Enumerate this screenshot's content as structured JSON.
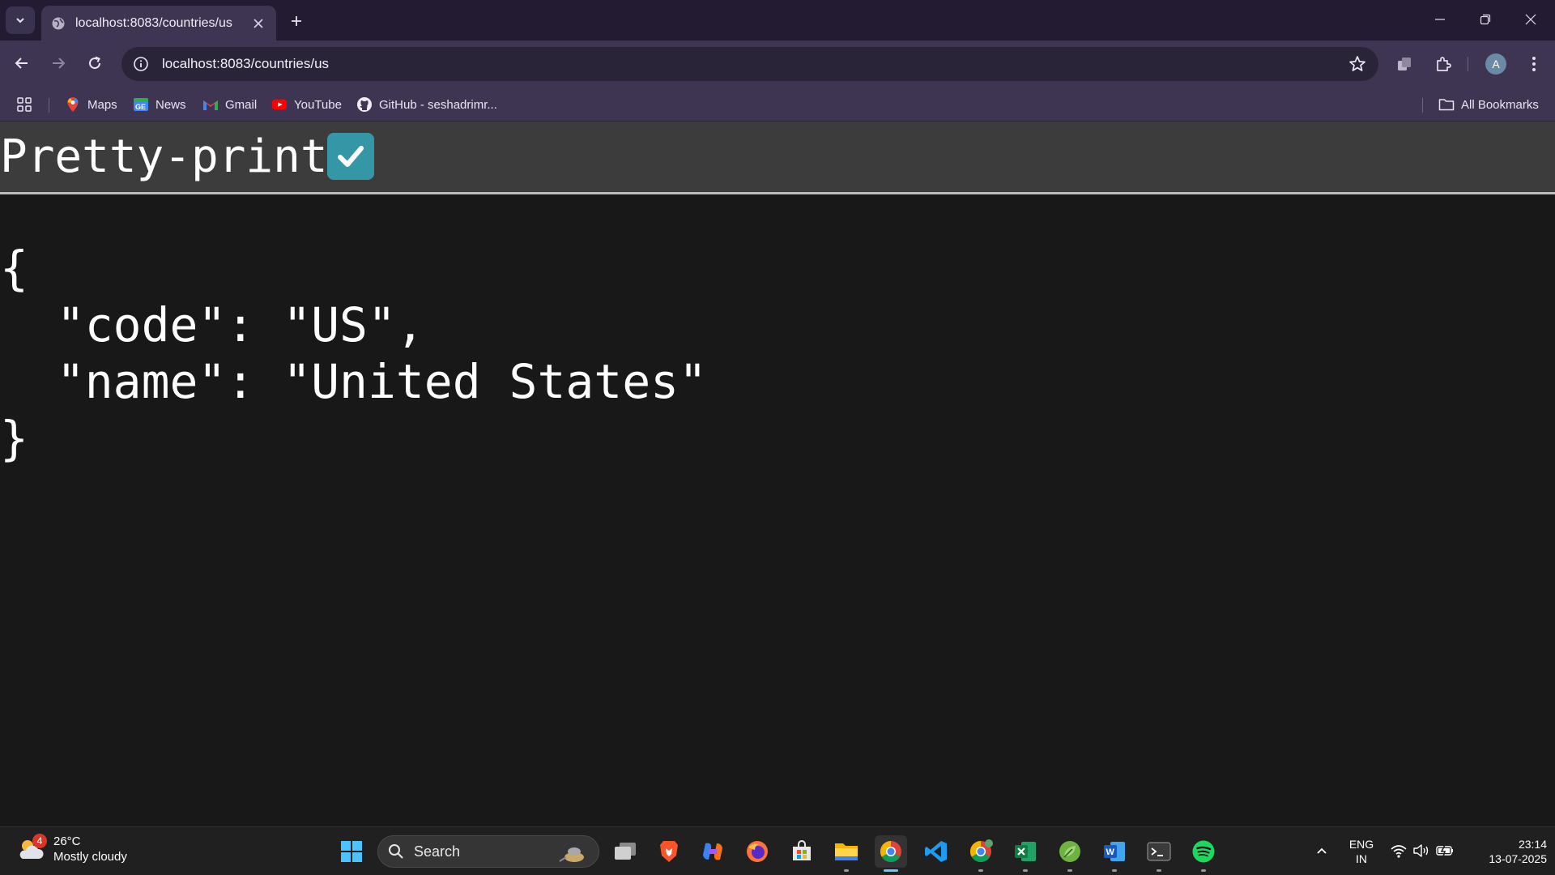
{
  "browser": {
    "tab": {
      "title": "localhost:8083/countries/us"
    },
    "omnibox": {
      "url": "localhost:8083/countries/us"
    },
    "bookmarks": [
      {
        "label": "Maps",
        "icon": "maps-icon"
      },
      {
        "label": "News",
        "icon": "news-icon"
      },
      {
        "label": "Gmail",
        "icon": "gmail-icon"
      },
      {
        "label": "YouTube",
        "icon": "youtube-icon"
      },
      {
        "label": "GitHub - seshadrimr...",
        "icon": "github-icon"
      }
    ],
    "all_bookmarks_label": "All Bookmarks",
    "avatar_letter": "A"
  },
  "page": {
    "pretty_print_label": "Pretty-print",
    "pretty_print_checked": true,
    "json_lines": [
      "{",
      "  \"code\": \"US\",",
      "  \"name\": \"United States\"",
      "}"
    ]
  },
  "taskbar": {
    "weather": {
      "temp": "26°C",
      "condition": "Mostly cloudy",
      "badge": "4"
    },
    "search_placeholder": "Search",
    "language": {
      "line1": "ENG",
      "line2": "IN"
    },
    "clock": {
      "time": "23:14",
      "date": "13-07-2025"
    }
  },
  "colors": {
    "titlebar": "#221b31",
    "toolbar": "#3d3552",
    "page_bg": "#181818",
    "checkbox_accent": "#3597a6",
    "taskbar": "#202020"
  }
}
